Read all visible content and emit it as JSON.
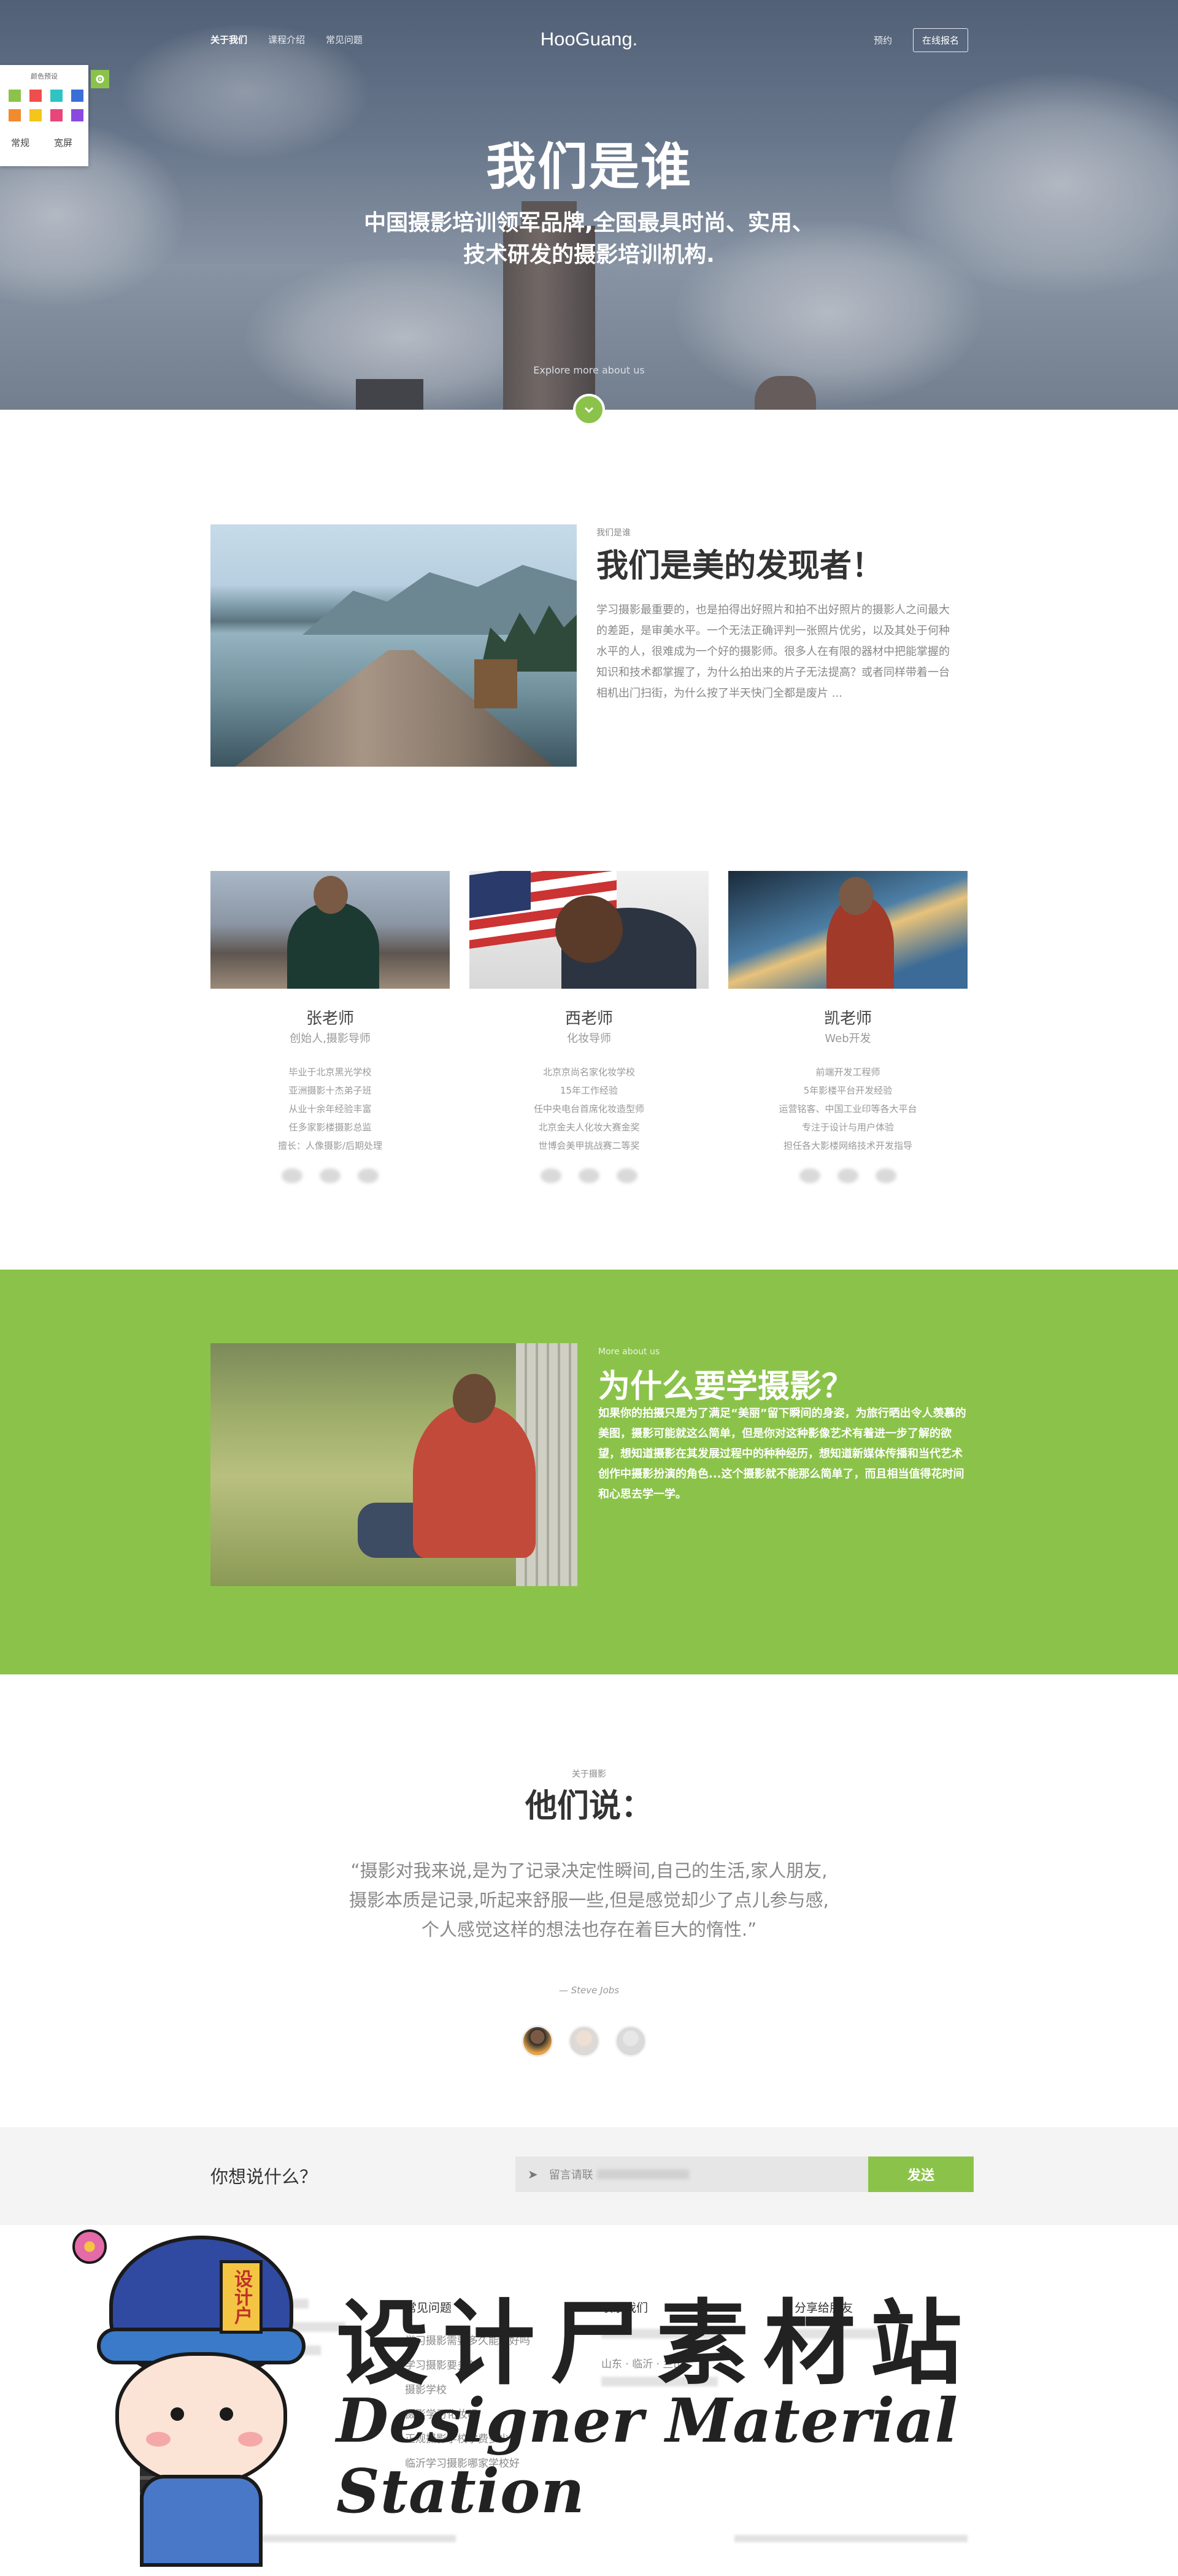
{
  "nav": {
    "left": [
      "关于我们",
      "课程介绍",
      "常见问题"
    ],
    "logo": "HooGuang.",
    "right_link": "预约",
    "right_button": "在线报名"
  },
  "color_panel": {
    "title": "颜色预设",
    "swatches": [
      "#8bc34a",
      "#f04e4e",
      "#2ec4c4",
      "#3b6fd8",
      "#f28a2e",
      "#f4c51a",
      "#e8457a",
      "#8a4ae0"
    ],
    "options": [
      "常规",
      "宽屏"
    ]
  },
  "hero": {
    "title": "我们是谁",
    "subtitle_line1": "中国摄影培训领军品牌,全国最具时尚、实用、",
    "subtitle_line2": "技术研发的摄影培训机构.",
    "explore": "Explore more about us"
  },
  "about": {
    "small": "我们是谁",
    "title": "我们是美的发现者！",
    "text": "学习摄影最重要的，也是拍得出好照片和拍不出好照片的摄影人之间最大的差距，是审美水平。一个无法正确评判一张照片优劣，以及其处于何种水平的人，很难成为一个好的摄影师。很多人在有限的器材中把能掌握的知识和技术都掌握了，为什么拍出来的片子无法提高？或者同样带着一台相机出门扫街，为什么按了半天快门全都是废片 ..."
  },
  "teachers": [
    {
      "name": "张老师",
      "role": "创始人,摄影导师",
      "lines": [
        "毕业于北京黑光学校",
        "亚洲摄影十杰弟子班",
        "从业十余年经验丰富",
        "任多家影楼摄影总监",
        "擅长：人像摄影/后期处理"
      ]
    },
    {
      "name": "西老师",
      "role": "化妆导师",
      "lines": [
        "北京京尚名家化妆学校",
        "15年工作经验",
        "任中央电台首席化妆造型师",
        "北京金夫人化妆大赛金奖",
        "世博会美甲挑战赛二等奖"
      ]
    },
    {
      "name": "凯老师",
      "role": "Web开发",
      "lines": [
        "前端开发工程师",
        "5年影楼平台开发经验",
        "运营铭客、中国工业印等各大平台",
        "专注于设计与用户体验",
        "担任各大影楼网络技术开发指导"
      ]
    }
  ],
  "why": {
    "small": "More about us",
    "title": "为什么要学摄影？",
    "text": "如果你的拍摄只是为了满足“美丽”留下瞬间的身姿，为旅行晒出令人羡慕的美图，摄影可能就这么简单，但是你对这种影像艺术有着进一步了解的欲望，想知道摄影在其发展过程中的种种经历，想知道新媒体传播和当代艺术创作中摄影扮演的角色...这个摄影就不能那么简单了，而且相当值得花时间和心思去学一学。"
  },
  "testimonial": {
    "small": "关于摄影",
    "title": "他们说：",
    "quote": "“摄影对我来说,是为了记录决定性瞬间,自己的生活,家人朋友,摄影本质是记录,听起来舒服一些,但是感觉却少了点儿参与感,个人感觉这样的想法也存在着巨大的惰性.”",
    "author": "— Steve Jobs"
  },
  "contact": {
    "label": "你想说什么？",
    "placeholder": "留言请联",
    "send": "发送"
  },
  "footer": {
    "col1_title": "常见问题",
    "col1_items": [
      "学习摄影需要多久能学好吗",
      "学习摄影要多久",
      "摄影学校",
      "摄影学习化妆吗",
      "正规摄影学校学费多少",
      "临沂学习摄影哪家学校好"
    ],
    "col2_title": "联系我们",
    "col2_items": [
      "山东 · 临沂 · 兰山"
    ],
    "col3_title": "分享给朋友"
  },
  "watermark": {
    "badge": "设计户",
    "cn": "设计尸素材站",
    "en": "Designer Material Station"
  }
}
